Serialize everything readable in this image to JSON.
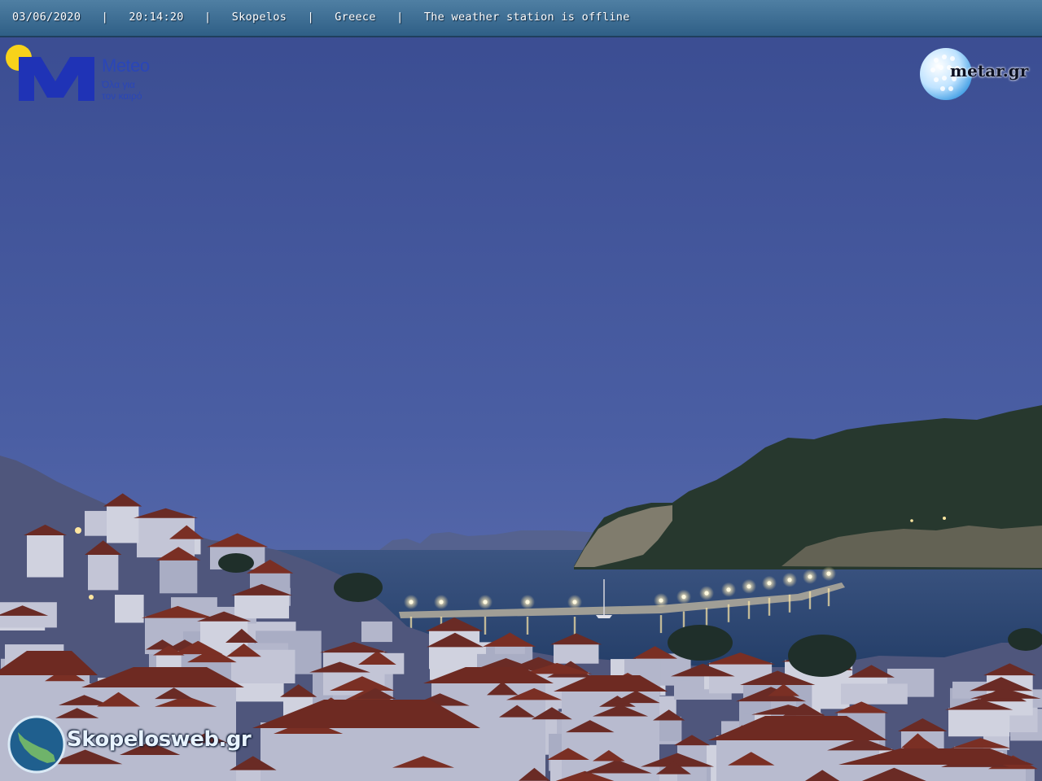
{
  "overlay": {
    "date": "03/06/2020",
    "time": "20:14:20",
    "location": "Skopelos",
    "country": "Greece",
    "status": "The weather station is offline",
    "separator": "|"
  },
  "logos": {
    "meteo_letter": "M",
    "meteo_word": "Meteo",
    "meteo_slogan_line1": "Όλα για",
    "meteo_slogan_line2": "τον καιρό",
    "metar": "metar.gr",
    "skopelosweb": "Skopelosweb.gr"
  },
  "colors": {
    "sky_top": "#3a4d93",
    "sky_bottom": "#5b6eaf",
    "sea": "#2c4873",
    "mountain": "#26372d",
    "roofs": "#7a2f24",
    "houses": "#b6b9cc",
    "lights": "#ffe9a8",
    "meteo_blue": "#2233b8",
    "meteo_sun": "#f7d21a"
  }
}
